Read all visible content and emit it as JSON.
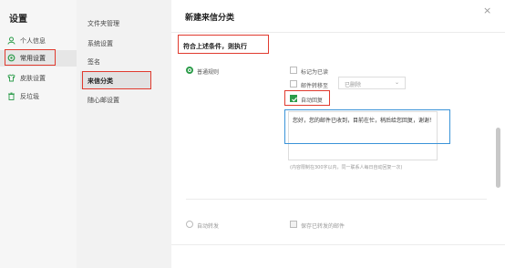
{
  "nav": {
    "title": "设置",
    "items": [
      {
        "label": "个人信息",
        "icon": "user-icon"
      },
      {
        "label": "常用设置",
        "icon": "gear-icon"
      },
      {
        "label": "皮肤设置",
        "icon": "shirt-icon"
      },
      {
        "label": "反垃圾",
        "icon": "trash-icon"
      }
    ]
  },
  "sublist": {
    "items": [
      "文件夹管理",
      "系统设置",
      "签名",
      "来信分类",
      "随心邮设置"
    ]
  },
  "dialog": {
    "title": "新建来信分类",
    "close": "×",
    "section_title": "符合上述条件，则执行",
    "rule_normal": "普通规则",
    "mark_read": "标记为已读",
    "move_mail": "邮件转移至",
    "move_select": "已删除",
    "auto_reply": "自动回复",
    "reply_text": "您好，您的邮件已收到，目前在忙，稍后给您回复，谢谢！",
    "reply_hint": "(内容限制在300字以内，同一联系人每日自动回复一次)",
    "auto_forward": "自动转发",
    "keep_forwarded": "保存已转发的邮件"
  },
  "colors": {
    "accent_green": "#2c9c4a",
    "highlight_red": "#e03a2e",
    "highlight_blue": "#3a93d8"
  }
}
